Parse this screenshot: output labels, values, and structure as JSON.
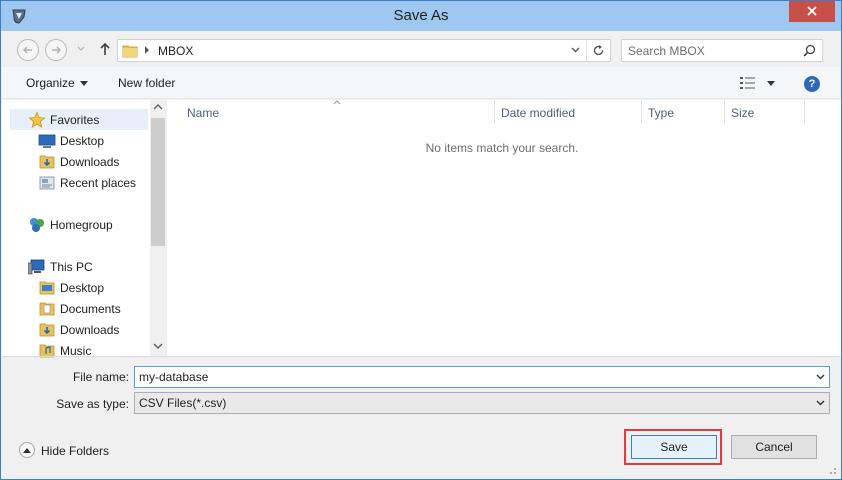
{
  "window": {
    "title": "Save As"
  },
  "nav": {
    "address": "MBOX",
    "search_placeholder": "Search MBOX"
  },
  "toolbar": {
    "organize_label": "Organize",
    "new_folder_label": "New folder",
    "help_label": "?"
  },
  "navpane": {
    "favorites_label": "Favorites",
    "items": [
      {
        "label": "Desktop",
        "icon": "desktop-icon"
      },
      {
        "label": "Downloads",
        "icon": "downloads-folder-icon"
      },
      {
        "label": "Recent places",
        "icon": "recent-places-icon"
      },
      {
        "label": "Homegroup",
        "icon": "homegroup-icon"
      },
      {
        "label": "This PC",
        "icon": "computer-icon"
      },
      {
        "label": "Desktop",
        "icon": "folder-icon"
      },
      {
        "label": "Documents",
        "icon": "folder-icon"
      },
      {
        "label": "Downloads",
        "icon": "downloads-folder-icon"
      },
      {
        "label": "Music",
        "icon": "folder-icon"
      }
    ]
  },
  "filelist": {
    "columns": [
      "Name",
      "Date modified",
      "Type",
      "Size"
    ],
    "empty_message": "No items match your search."
  },
  "form": {
    "filename_label": "File name:",
    "filename_value": "my-database",
    "type_label": "Save as type:",
    "type_value": "CSV Files(*.csv)"
  },
  "footer": {
    "hide_folders_label": "Hide Folders",
    "save_label": "Save",
    "cancel_label": "Cancel"
  },
  "colors": {
    "titlebar": "#9ec8f0",
    "close": "#c7504a",
    "focus_highlight": "#e03c3c",
    "accent": "#3c7fc6"
  }
}
